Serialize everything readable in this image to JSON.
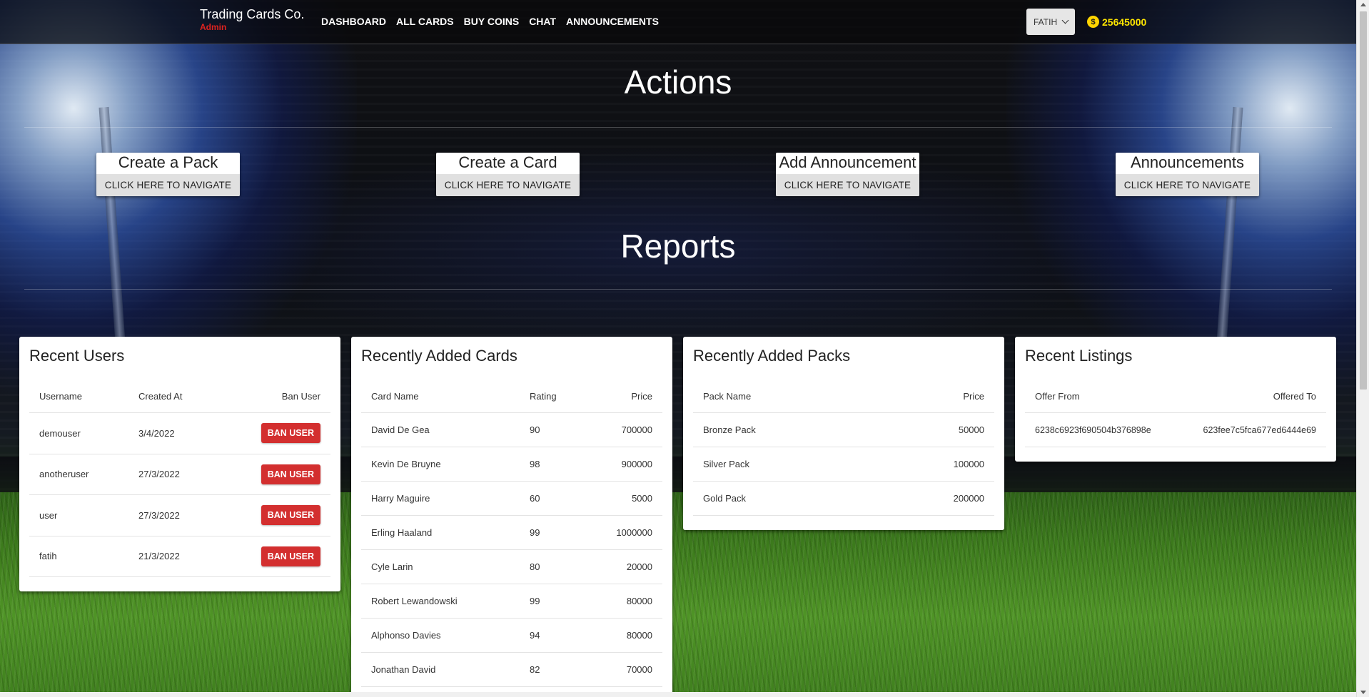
{
  "header": {
    "brand_title": "Trading Cards Co.",
    "brand_role": "Admin",
    "nav": [
      "DASHBOARD",
      "ALL CARDS",
      "BUY COINS",
      "CHAT",
      "ANNOUNCEMENTS"
    ],
    "user_name": "FATIH",
    "coin_symbol": "$",
    "coins": "25645000"
  },
  "actions": {
    "title": "Actions",
    "button_label": "CLICK HERE TO NAVIGATE",
    "cards": [
      "Create a Pack",
      "Create a Card",
      "Add Announcement",
      "Announcements"
    ]
  },
  "reports": {
    "title": "Reports",
    "recent_users": {
      "title": "Recent Users",
      "headers": [
        "Username",
        "Created At",
        "Ban User"
      ],
      "ban_label": "BAN USER",
      "rows": [
        [
          "demouser",
          "3/4/2022"
        ],
        [
          "anotheruser",
          "27/3/2022"
        ],
        [
          "user",
          "27/3/2022"
        ],
        [
          "fatih",
          "21/3/2022"
        ]
      ]
    },
    "recent_cards": {
      "title": "Recently Added Cards",
      "headers": [
        "Card Name",
        "Rating",
        "Price"
      ],
      "rows": [
        [
          "David De Gea",
          "90",
          "700000"
        ],
        [
          "Kevin De Bruyne",
          "98",
          "900000"
        ],
        [
          "Harry Maguire",
          "60",
          "5000"
        ],
        [
          "Erling Haaland",
          "99",
          "1000000"
        ],
        [
          "Cyle Larin",
          "80",
          "20000"
        ],
        [
          "Robert Lewandowski",
          "99",
          "80000"
        ],
        [
          "Alphonso Davies",
          "94",
          "80000"
        ],
        [
          "Jonathan David",
          "82",
          "70000"
        ]
      ]
    },
    "recent_packs": {
      "title": "Recently Added Packs",
      "headers": [
        "Pack Name",
        "Price"
      ],
      "rows": [
        [
          "Bronze Pack",
          "50000"
        ],
        [
          "Silver Pack",
          "100000"
        ],
        [
          "Gold Pack",
          "200000"
        ]
      ]
    },
    "recent_listings": {
      "title": "Recent Listings",
      "headers": [
        "Offer From",
        "Offered To"
      ],
      "rows": [
        [
          "6238c6923f690504b376898e",
          "623fee7c5fca677ed6444e69"
        ]
      ]
    }
  }
}
